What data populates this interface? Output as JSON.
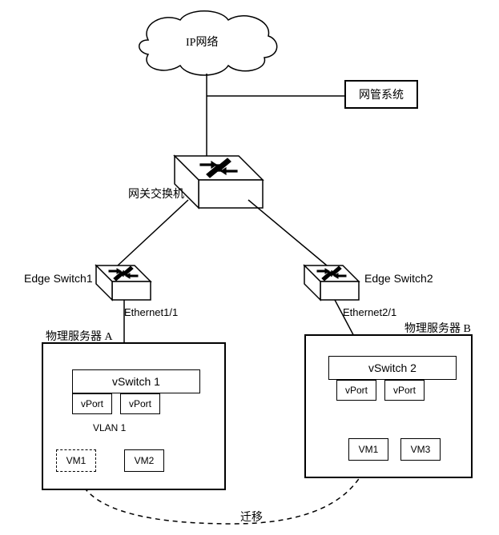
{
  "cloud": {
    "label": "IP网络"
  },
  "nms": {
    "label": "网管系统"
  },
  "gateway": {
    "label": "网关交换机"
  },
  "edge1": {
    "label": "Edge Switch1",
    "iface": "Ethernet1/1"
  },
  "edge2": {
    "label": "Edge Switch2",
    "iface": "Ethernet2/1"
  },
  "serverA": {
    "label": "物理服务器 A",
    "vswitch": "vSwitch 1",
    "vport1": "vPort",
    "vport2": "vPort",
    "vlan": "VLAN 1",
    "vm1": "VM1",
    "vm2": "VM2"
  },
  "serverB": {
    "label": "物理服务器 B",
    "vswitch": "vSwitch 2",
    "vport1": "vPort",
    "vport2": "vPort",
    "vm1": "VM1",
    "vm3": "VM3"
  },
  "migration": {
    "label": "迁移"
  }
}
